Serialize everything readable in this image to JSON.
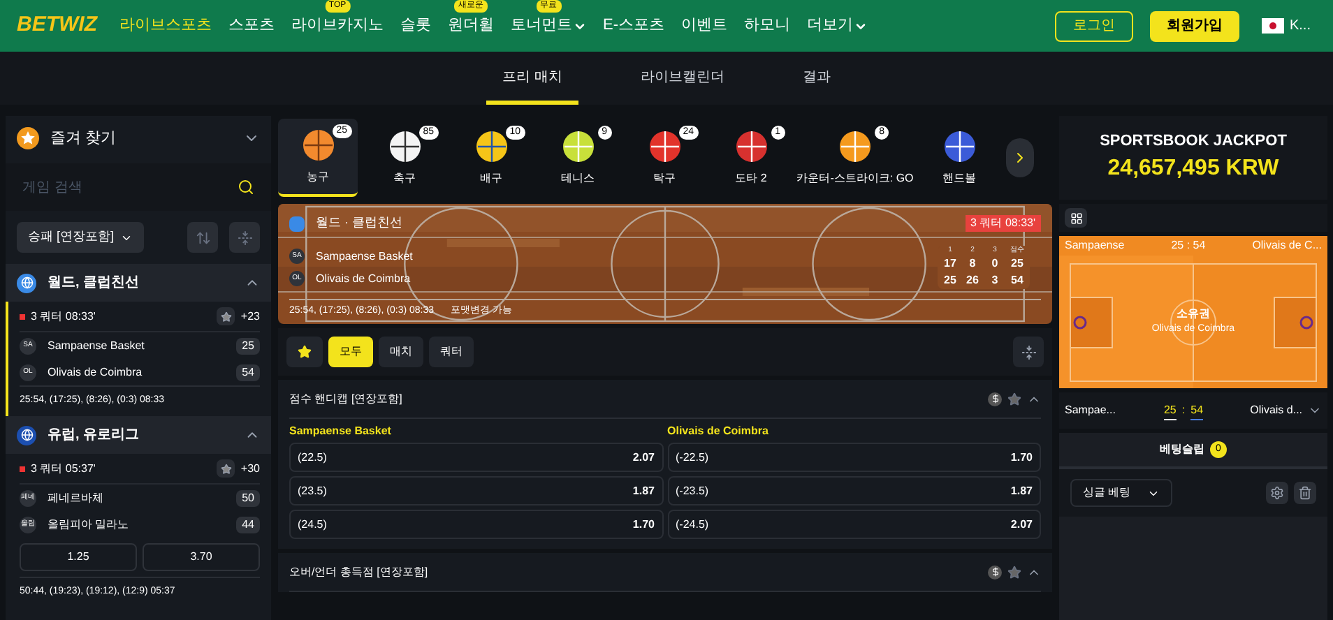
{
  "header": {
    "logo": "BETWIZ",
    "nav": [
      {
        "label": "라이브스포츠",
        "selected": true
      },
      {
        "label": "스포츠",
        "selected": false
      },
      {
        "label": "라이브카지노",
        "selected": false,
        "badge": "TOP"
      },
      {
        "label": "슬롯",
        "selected": false
      },
      {
        "label": "원더휠",
        "selected": false,
        "badge": "새로운"
      },
      {
        "label": "토너먼트",
        "selected": false,
        "badge": "무료",
        "dropdown": true
      },
      {
        "label": "E-스포츠",
        "selected": false
      },
      {
        "label": "이벤트",
        "selected": false
      },
      {
        "label": "하모니",
        "selected": false
      },
      {
        "label": "더보기",
        "selected": false,
        "dropdown": true
      }
    ],
    "login": "로그인",
    "signup": "회원가입",
    "language": "K..."
  },
  "subtabs": [
    {
      "label": "프리 매치",
      "selected": true
    },
    {
      "label": "라이브캘린더",
      "selected": false
    },
    {
      "label": "결과",
      "selected": false
    }
  ],
  "sidebar": {
    "favorites": "즐겨 찾기",
    "search": {
      "placeholder": "게임 검색"
    },
    "filter": "승패 [연장포함]",
    "leagues": [
      {
        "name": "월드, 클럽친선",
        "kind": "world",
        "match": {
          "selected": true,
          "status": "3 쿼터 08:33'",
          "more": "+23",
          "teams": [
            {
              "abbr": "SA",
              "name": "Sampaense Basket",
              "score": "25"
            },
            {
              "abbr": "OL",
              "name": "Olivais de Coimbra",
              "score": "54"
            }
          ],
          "summary": "25:54, (17:25), (8:26), (0:3) 08:33"
        }
      },
      {
        "name": "유럽, 유로리그",
        "kind": "europe",
        "match": {
          "selected": false,
          "status": "3 쿼터 05:37'",
          "more": "+30",
          "teams": [
            {
              "abbr": "페네",
              "name": "페네르바체",
              "score": "50"
            },
            {
              "abbr": "올림",
              "name": "올림피아 밀라노",
              "score": "44"
            }
          ],
          "odds": [
            "1.25",
            "3.70"
          ],
          "summary": "50:44, (19:23), (19:12), (12:9) 05:37"
        }
      }
    ]
  },
  "sports": [
    {
      "label": "농구",
      "count": "25",
      "kind": "basketball",
      "selected": true
    },
    {
      "label": "축구",
      "count": "85",
      "kind": "soccer",
      "selected": false
    },
    {
      "label": "배구",
      "count": "10",
      "kind": "volleyball",
      "selected": false
    },
    {
      "label": "테니스",
      "count": "9",
      "kind": "tennis",
      "selected": false
    },
    {
      "label": "탁구",
      "count": "24",
      "kind": "pingpong",
      "selected": false
    },
    {
      "label": "도타 2",
      "count": "1",
      "kind": "dota",
      "selected": false
    },
    {
      "label": "카운터-스트라이크: GO",
      "count": "8",
      "kind": "cs",
      "selected": false
    },
    {
      "label": "핸드볼",
      "kind": "handball",
      "selected": false
    }
  ],
  "match": {
    "league": "월드 · 클럽친선",
    "status": "3 쿼터 08:33'",
    "periods": [
      "1",
      "2",
      "3",
      "점수"
    ],
    "teams": [
      {
        "abbr": "SA",
        "name": "Sampaense Basket",
        "scores": [
          "17",
          "8",
          "0",
          "25"
        ]
      },
      {
        "abbr": "OL",
        "name": "Olivais de Coimbra",
        "scores": [
          "25",
          "26",
          "3",
          "54"
        ]
      }
    ],
    "summary": "25:54, (17:25), (8:26), (0:3) 08:33",
    "note": "포맷변경 가능"
  },
  "market_filters": [
    {
      "label": "모두",
      "selected": true
    },
    {
      "label": "매치",
      "selected": false
    },
    {
      "label": "쿼터",
      "selected": false
    }
  ],
  "markets": [
    {
      "title": "점수 핸디캡 [연장포함]",
      "teams": [
        "Sampaense Basket",
        "Olivais de Coimbra"
      ],
      "rows": [
        [
          {
            "line": "(22.5)",
            "odd": "2.07"
          },
          {
            "line": "(-22.5)",
            "odd": "1.70"
          }
        ],
        [
          {
            "line": "(23.5)",
            "odd": "1.87"
          },
          {
            "line": "(-23.5)",
            "odd": "1.87"
          }
        ],
        [
          {
            "line": "(24.5)",
            "odd": "1.70"
          },
          {
            "line": "(-24.5)",
            "odd": "2.07"
          }
        ]
      ]
    },
    {
      "title": "오버/언더 총득점 [연장포함]"
    }
  ],
  "right": {
    "jackpot_title": "SPORTSBOOK JACKPOT",
    "jackpot_amount": "24,657,495 KRW",
    "tracker": {
      "home": "Sampaense",
      "score": "25 : 54",
      "away": "Olivais de C...",
      "possession": "소유권",
      "possession_team": "Olivais de Coimbra"
    },
    "scoreline": {
      "home": "Sampae...",
      "home_score": "25",
      "separator": ":",
      "away_score": "54",
      "away": "Olivais d..."
    },
    "betslip": {
      "title": "베팅슬립",
      "count": "0",
      "mode": "싱글 베팅"
    }
  }
}
